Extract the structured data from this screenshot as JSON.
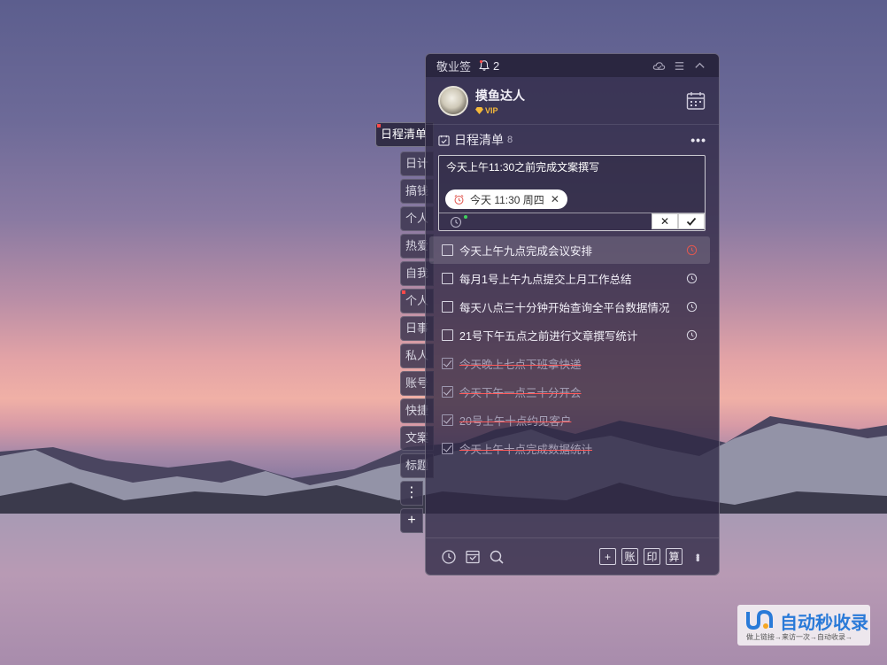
{
  "app": {
    "title": "敬业签",
    "notification_count": "2"
  },
  "user": {
    "name": "摸鱼达人",
    "badge": "VIP"
  },
  "list": {
    "title": "日程清单",
    "count": "8"
  },
  "side_tabs": [
    {
      "label": "日程清单",
      "active": true,
      "flag": true
    },
    {
      "label": "日计"
    },
    {
      "label": "搞钱"
    },
    {
      "label": "个人"
    },
    {
      "label": "热爱"
    },
    {
      "label": "自我"
    },
    {
      "label": "个人",
      "flag": true
    },
    {
      "label": "日事"
    },
    {
      "label": "私人"
    },
    {
      "label": "账号"
    },
    {
      "label": "快捷"
    },
    {
      "label": "文案"
    },
    {
      "label": "标题"
    }
  ],
  "editor": {
    "text": "今天上午11:30之前完成文案撰写",
    "reminder_chip": "今天 11:30 周四",
    "cancel_symbol": "✕"
  },
  "tasks": [
    {
      "label": "今天上午九点完成会议安排",
      "done": false,
      "reminder": "active"
    },
    {
      "label": "每月1号上午九点提交上月工作总结",
      "done": false,
      "reminder": "normal"
    },
    {
      "label": "每天八点三十分钟开始查询全平台数据情况",
      "done": false,
      "reminder": "normal"
    },
    {
      "label": "21号下午五点之前进行文章撰写统计",
      "done": false,
      "reminder": "normal"
    },
    {
      "label": "今天晚上七点下班拿快递",
      "done": true
    },
    {
      "label": "今天下午一点三十分开会",
      "done": true
    },
    {
      "label": "20号上午十点约见客户",
      "done": true
    },
    {
      "label": "今天上午十点完成数据统计",
      "done": true
    }
  ],
  "footer": {
    "buttons": [
      "+",
      "账",
      "印",
      "算"
    ]
  },
  "watermark": {
    "main": "自动秒收录",
    "sub": "做上链接→来访一次→自动收录→"
  },
  "colors": {
    "panel": "#2e2844",
    "reminder_active": "#e0574f",
    "watermark_blue": "#2a7ad8",
    "vip": "#f5b93a"
  }
}
